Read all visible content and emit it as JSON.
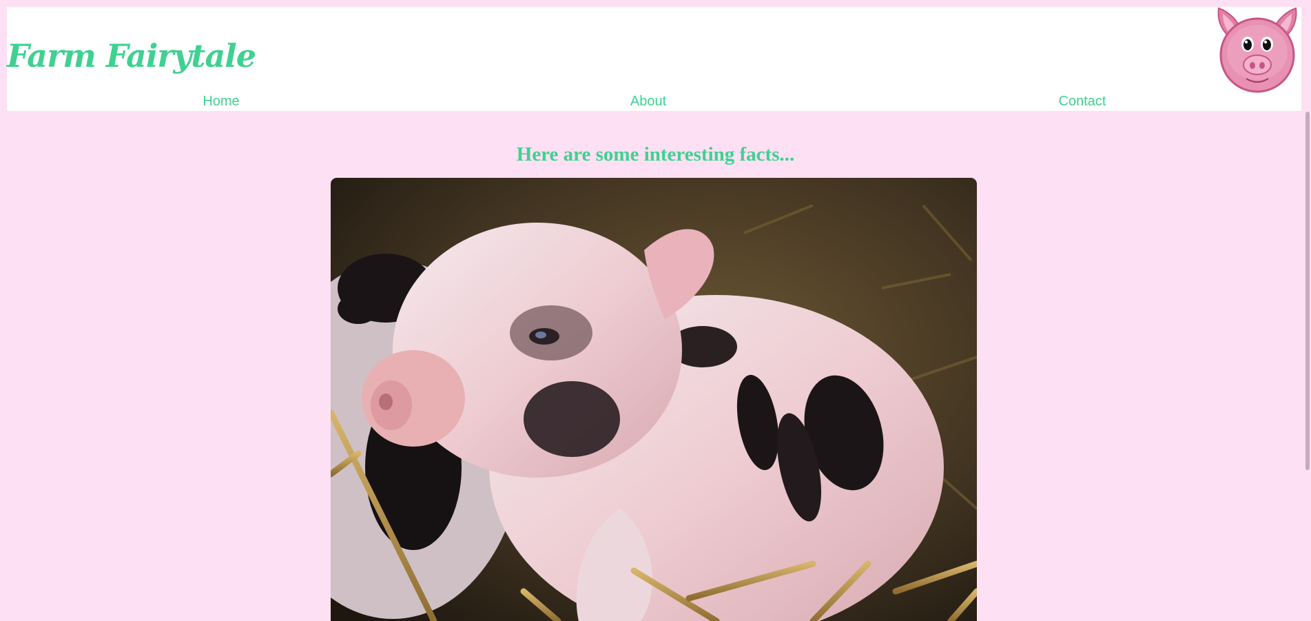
{
  "site": {
    "title": "Farm Fairytale",
    "logo_icon": "pig-face-icon"
  },
  "nav": {
    "items": [
      {
        "label": "Home"
      },
      {
        "label": "About"
      },
      {
        "label": "Contact"
      }
    ]
  },
  "main": {
    "headline": "Here are some interesting facts...",
    "photo_subject": "piglet-photo"
  },
  "colors": {
    "background": "#fde0f3",
    "accent": "#3fd191",
    "header_bg": "#ffffff",
    "pig_pink": "#e27fa5"
  }
}
